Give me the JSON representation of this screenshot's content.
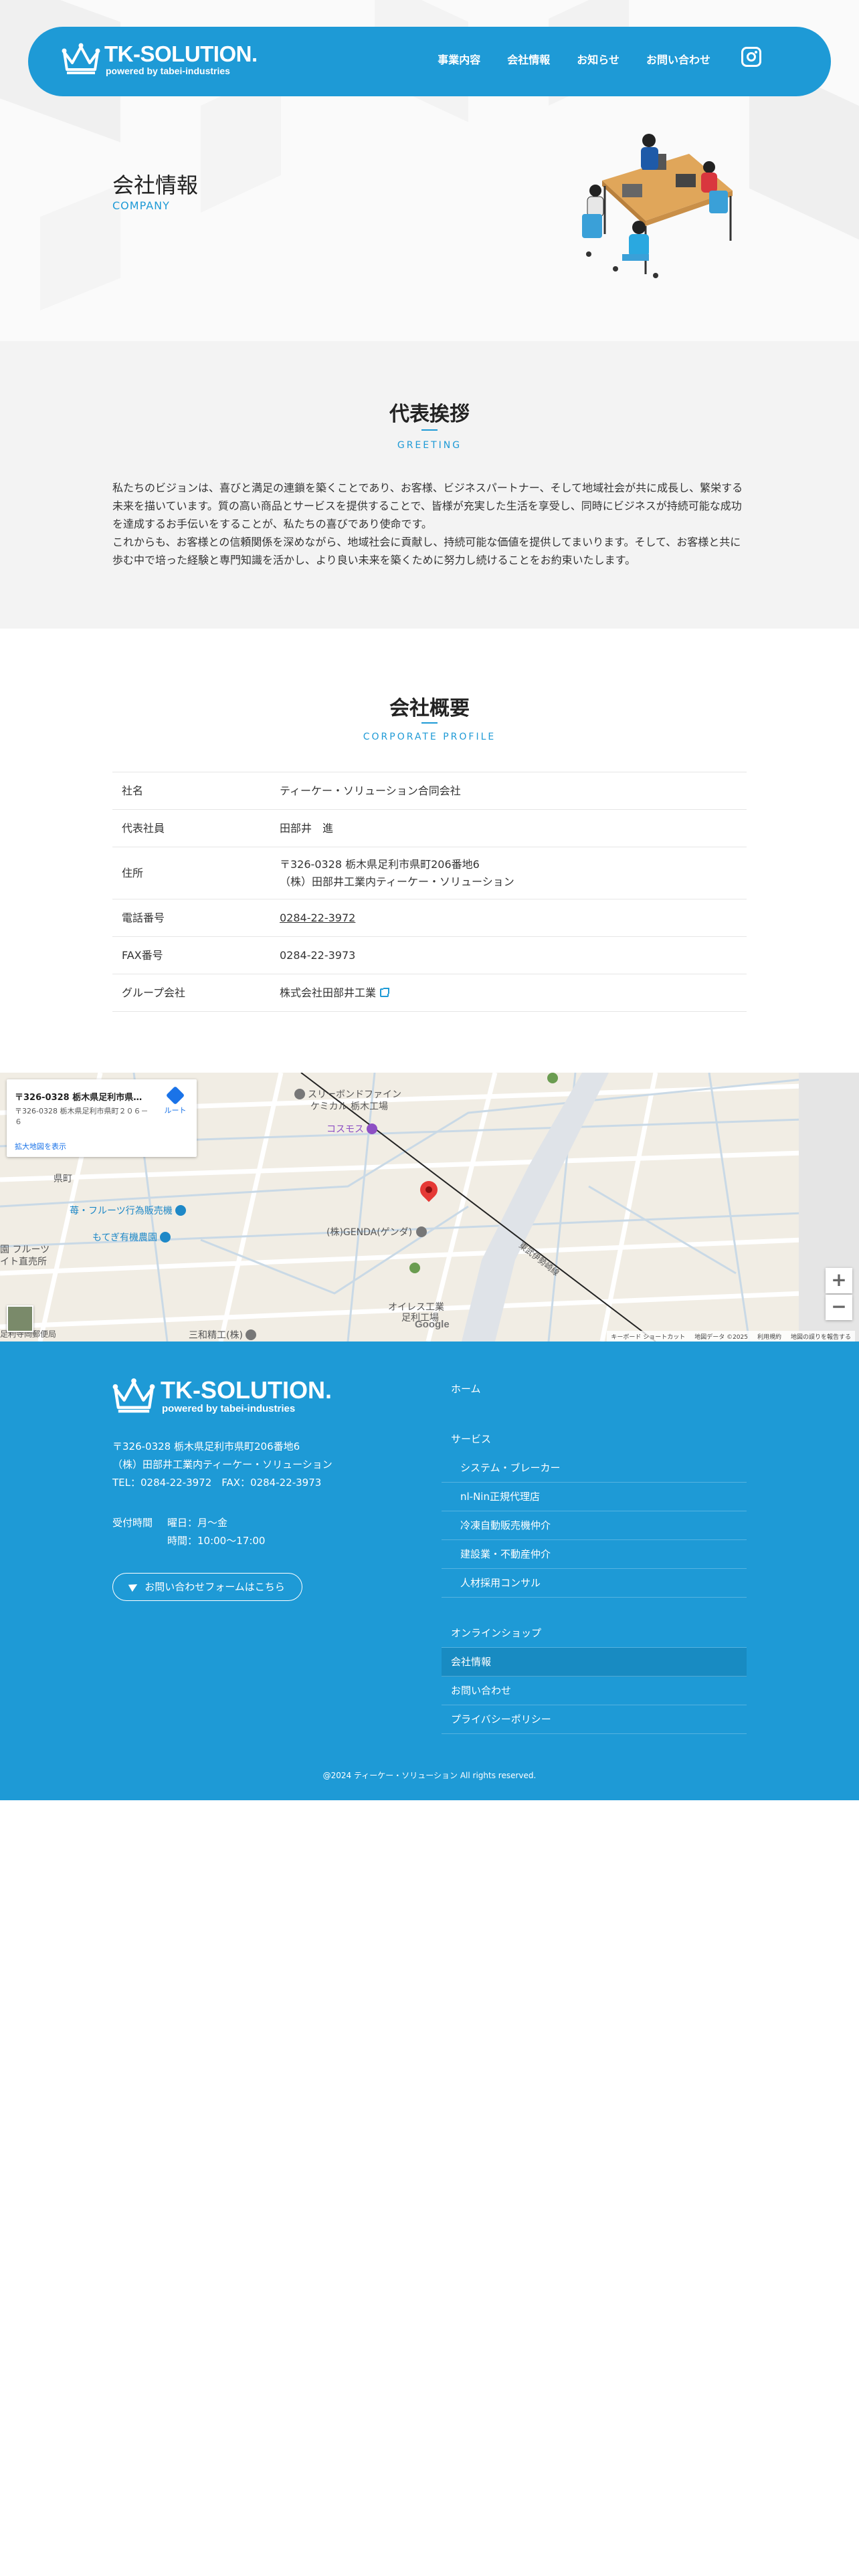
{
  "brand": {
    "name": "TK-SOLUTION.",
    "tagline": "powered by tabei-industries"
  },
  "nav": {
    "items": [
      "事業内容",
      "会社情報",
      "お知らせ",
      "お問い合わせ"
    ]
  },
  "hero": {
    "title": "会社情報",
    "subtitle": "COMPANY"
  },
  "greeting": {
    "title": "代表挨拶",
    "subtitle": "GREETING",
    "body": "私たちのビジョンは、喜びと満足の連鎖を築くことであり、お客様、ビジネスパートナー、そして地域社会が共に成長し、繁栄する未来を描いています。質の高い商品とサービスを提供することで、皆様が充実した生活を享受し、同時にビジネスが持続可能な成功を達成するお手伝いをすることが、私たちの喜びであり使命です。\nこれからも、お客様との信頼関係を深めながら、地域社会に貢献し、持続可能な価値を提供してまいります。そして、お客様と共に歩む中で培った経験と専門知識を活かし、より良い未来を築くために努力し続けることをお約束いたします。"
  },
  "profile": {
    "title": "会社概要",
    "subtitle": "CORPORATE PROFILE",
    "rows": [
      {
        "label": "社名",
        "value": "ティーケー・ソリューション合同会社"
      },
      {
        "label": "代表社員",
        "value": "田部井　進"
      },
      {
        "label": "住所",
        "value": "〒326-0328 栃木県足利市県町206番地6\n（株）田部井工業内ティーケー・ソリューション"
      },
      {
        "label": "電話番号",
        "value": "0284-22-3972"
      },
      {
        "label": "FAX番号",
        "value": "0284-22-3973"
      },
      {
        "label": "グループ会社",
        "value": "株式会社田部井工業"
      }
    ]
  },
  "map": {
    "card_title": "〒326-0328 栃木県足利市県町...",
    "card_address": "〒326-0328 栃木県足利市県町２０６－６",
    "card_link": "拡大地図を表示",
    "directions": "ルート",
    "labels": {
      "sleeve": "スリーボンドファイン",
      "sleeve2": "ケミカル 栃木工場",
      "cosmos": "コスモス",
      "genda": "(株)GENDA(ゲンダ)",
      "fruit": "苺・フルーツ行為販売機",
      "motegi": "もてぎ有機農園",
      "agata": "県町",
      "oiles": "オイレス工業",
      "oiles2": "足利工場",
      "sanwa": "三和精工(株)",
      "road": "東武伊勢崎線",
      "left1": "園 フルーツ",
      "left2": "イト直売所",
      "post": "足利寺岡郵便局"
    },
    "attribution": [
      "キーボード ショートカット",
      "地図データ ©2025",
      "利用規約",
      "地図の誤りを報告する"
    ],
    "google": "Google",
    "zoom_in": "+",
    "zoom_out": "−"
  },
  "footer": {
    "address_lines": [
      "〒326-0328 栃木県足利市県町206番地6",
      "（株）田部井工業内ティーケー・ソリューション",
      "TEL：0284-22-3972　FAX：0284-22-3973"
    ],
    "hours_label": "受付時間",
    "hours_days": "曜日：月〜金",
    "hours_time": "時間：10:00〜17:00",
    "contact_button": "お問い合わせフォームはこちら",
    "nav": {
      "home": "ホーム",
      "services": "サービス",
      "service_items": [
        "システム・ブレーカー",
        "nl-Nin正規代理店",
        "冷凍自動販売機仲介",
        "建設業・不動産仲介",
        "人材採用コンサル"
      ],
      "online_shop": "オンラインショップ",
      "company": "会社情報",
      "contact": "お問い合わせ",
      "privacy": "プライバシーポリシー"
    },
    "copyright": "@2024 ティーケー・ソリューション All rights reserved."
  },
  "colors": {
    "brand_blue": "#1e9ad6",
    "greeting_bg": "#f3f3f3",
    "map_bg": "#f1ede4",
    "pin_red": "#e53935"
  }
}
